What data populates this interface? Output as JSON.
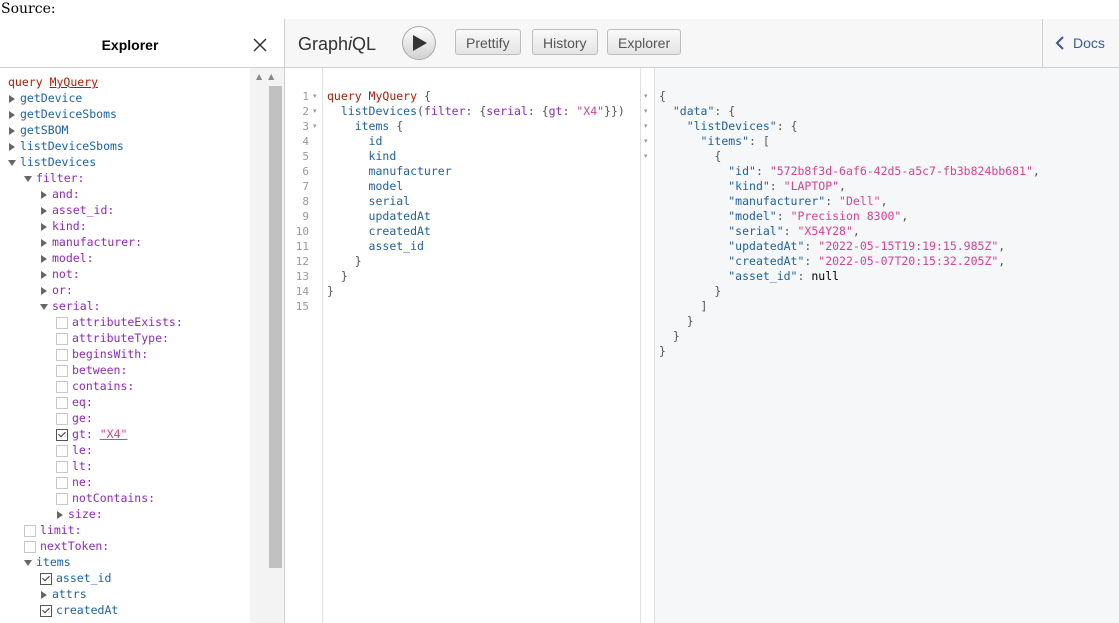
{
  "source_label": "Source:",
  "explorer": {
    "title": "Explorer",
    "query_keyword": "query",
    "query_name": "MyQuery",
    "items": [
      {
        "label": "getDevice",
        "type": "collapsed",
        "indent": 0
      },
      {
        "label": "getDeviceSboms",
        "type": "collapsed",
        "indent": 0
      },
      {
        "label": "getSBOM",
        "type": "collapsed",
        "indent": 0
      },
      {
        "label": "listDeviceSboms",
        "type": "collapsed",
        "indent": 0
      },
      {
        "label": "listDevices",
        "type": "expanded",
        "indent": 0
      },
      {
        "label": "filter:",
        "type": "expanded-arg",
        "indent": 1
      },
      {
        "label": "and:",
        "type": "collapsed-arg",
        "indent": 2
      },
      {
        "label": "asset_id:",
        "type": "collapsed-arg",
        "indent": 2
      },
      {
        "label": "kind:",
        "type": "collapsed-arg",
        "indent": 2
      },
      {
        "label": "manufacturer:",
        "type": "collapsed-arg",
        "indent": 2
      },
      {
        "label": "model:",
        "type": "collapsed-arg",
        "indent": 2
      },
      {
        "label": "not:",
        "type": "collapsed-arg",
        "indent": 2
      },
      {
        "label": "or:",
        "type": "collapsed-arg",
        "indent": 2
      },
      {
        "label": "serial:",
        "type": "expanded-arg",
        "indent": 2
      },
      {
        "label": "attributeExists:",
        "type": "check-arg",
        "indent": 3,
        "checked": false
      },
      {
        "label": "attributeType:",
        "type": "check-arg",
        "indent": 3,
        "checked": false
      },
      {
        "label": "beginsWith:",
        "type": "check-arg",
        "indent": 3,
        "checked": false
      },
      {
        "label": "between:",
        "type": "check-arg",
        "indent": 3,
        "checked": false
      },
      {
        "label": "contains:",
        "type": "check-arg",
        "indent": 3,
        "checked": false
      },
      {
        "label": "eq:",
        "type": "check-arg",
        "indent": 3,
        "checked": false
      },
      {
        "label": "ge:",
        "type": "check-arg",
        "indent": 3,
        "checked": false
      },
      {
        "label": "gt:",
        "type": "check-arg",
        "indent": 3,
        "checked": true,
        "value": "\"X4\""
      },
      {
        "label": "le:",
        "type": "check-arg",
        "indent": 3,
        "checked": false
      },
      {
        "label": "lt:",
        "type": "check-arg",
        "indent": 3,
        "checked": false
      },
      {
        "label": "ne:",
        "type": "check-arg",
        "indent": 3,
        "checked": false
      },
      {
        "label": "notContains:",
        "type": "check-arg",
        "indent": 3,
        "checked": false
      },
      {
        "label": "size:",
        "type": "collapsed-arg",
        "indent": 3
      },
      {
        "label": "limit:",
        "type": "check-arg",
        "indent": 1,
        "checked": false
      },
      {
        "label": "nextToken:",
        "type": "check-arg",
        "indent": 1,
        "checked": false
      },
      {
        "label": "items",
        "type": "expanded",
        "indent": 1
      },
      {
        "label": "asset_id",
        "type": "check-field",
        "indent": 2,
        "checked": true
      },
      {
        "label": "attrs",
        "type": "collapsed",
        "indent": 2
      },
      {
        "label": "createdAt",
        "type": "check-field",
        "indent": 2,
        "checked": true
      }
    ]
  },
  "toolbar": {
    "logo_pre": "Graph",
    "logo_i": "i",
    "logo_post": "QL",
    "prettify": "Prettify",
    "history": "History",
    "explorer": "Explorer",
    "docs": "Docs"
  },
  "query_lines": [
    [
      [
        "kw",
        "query "
      ],
      [
        "qn",
        "MyQuery"
      ],
      [
        "p",
        " {"
      ]
    ],
    [
      [
        "p",
        "  "
      ],
      [
        "f",
        "listDevices"
      ],
      [
        "p",
        "("
      ],
      [
        "a",
        "filter"
      ],
      [
        "p",
        ": {"
      ],
      [
        "a",
        "serial"
      ],
      [
        "p",
        ": {"
      ],
      [
        "a",
        "gt"
      ],
      [
        "p",
        ": "
      ],
      [
        "s",
        "\"X4\""
      ],
      [
        "p",
        "}})"
      ]
    ],
    [
      [
        "p",
        "    "
      ],
      [
        "f",
        "items"
      ],
      [
        "p",
        " {"
      ]
    ],
    [
      [
        "p",
        "      "
      ],
      [
        "f",
        "id"
      ]
    ],
    [
      [
        "p",
        "      "
      ],
      [
        "f",
        "kind"
      ]
    ],
    [
      [
        "p",
        "      "
      ],
      [
        "f",
        "manufacturer"
      ]
    ],
    [
      [
        "p",
        "      "
      ],
      [
        "f",
        "model"
      ]
    ],
    [
      [
        "p",
        "      "
      ],
      [
        "f",
        "serial"
      ]
    ],
    [
      [
        "p",
        "      "
      ],
      [
        "f",
        "updatedAt"
      ]
    ],
    [
      [
        "p",
        "      "
      ],
      [
        "f",
        "createdAt"
      ]
    ],
    [
      [
        "p",
        "      "
      ],
      [
        "f",
        "asset_id"
      ]
    ],
    [
      [
        "p",
        "    }"
      ]
    ],
    [
      [
        "p",
        "  }"
      ]
    ],
    [
      [
        "p",
        "}"
      ]
    ],
    [
      [
        "p",
        ""
      ]
    ]
  ],
  "query_folds": [
    1,
    2,
    3
  ],
  "result_lines": [
    [
      [
        "p",
        "{"
      ]
    ],
    [
      [
        "p",
        "  "
      ],
      [
        "k",
        "\"data\""
      ],
      [
        "p",
        ": {"
      ]
    ],
    [
      [
        "p",
        "    "
      ],
      [
        "k",
        "\"listDevices\""
      ],
      [
        "p",
        ": {"
      ]
    ],
    [
      [
        "p",
        "      "
      ],
      [
        "k",
        "\"items\""
      ],
      [
        "p",
        ": ["
      ]
    ],
    [
      [
        "p",
        "        {"
      ]
    ],
    [
      [
        "p",
        "          "
      ],
      [
        "k",
        "\"id\""
      ],
      [
        "p",
        ": "
      ],
      [
        "s",
        "\"572b8f3d-6af6-42d5-a5c7-fb3b824bb681\""
      ],
      [
        "p",
        ","
      ]
    ],
    [
      [
        "p",
        "          "
      ],
      [
        "k",
        "\"kind\""
      ],
      [
        "p",
        ": "
      ],
      [
        "s",
        "\"LAPTOP\""
      ],
      [
        "p",
        ","
      ]
    ],
    [
      [
        "p",
        "          "
      ],
      [
        "k",
        "\"manufacturer\""
      ],
      [
        "p",
        ": "
      ],
      [
        "s",
        "\"Dell\""
      ],
      [
        "p",
        ","
      ]
    ],
    [
      [
        "p",
        "          "
      ],
      [
        "k",
        "\"model\""
      ],
      [
        "p",
        ": "
      ],
      [
        "s",
        "\"Precision 8300\""
      ],
      [
        "p",
        ","
      ]
    ],
    [
      [
        "p",
        "          "
      ],
      [
        "k",
        "\"serial\""
      ],
      [
        "p",
        ": "
      ],
      [
        "s",
        "\"X54Y28\""
      ],
      [
        "p",
        ","
      ]
    ],
    [
      [
        "p",
        "          "
      ],
      [
        "k",
        "\"updatedAt\""
      ],
      [
        "p",
        ": "
      ],
      [
        "s",
        "\"2022-05-15T19:19:15.985Z\""
      ],
      [
        "p",
        ","
      ]
    ],
    [
      [
        "p",
        "          "
      ],
      [
        "k",
        "\"createdAt\""
      ],
      [
        "p",
        ": "
      ],
      [
        "s",
        "\"2022-05-07T20:15:32.205Z\""
      ],
      [
        "p",
        ","
      ]
    ],
    [
      [
        "p",
        "          "
      ],
      [
        "k",
        "\"asset_id\""
      ],
      [
        "p",
        ": "
      ],
      [
        "n",
        "null"
      ]
    ],
    [
      [
        "p",
        "        }"
      ]
    ],
    [
      [
        "p",
        "      ]"
      ]
    ],
    [
      [
        "p",
        "    }"
      ]
    ],
    [
      [
        "p",
        "  }"
      ]
    ],
    [
      [
        "p",
        "}"
      ]
    ]
  ],
  "result_folds": 5,
  "colors": {
    "keyword": "#b11a04",
    "field": "#1f61a0",
    "argument": "#8b2bb9",
    "string": "#d64292",
    "docs_link": "#3b5998"
  }
}
